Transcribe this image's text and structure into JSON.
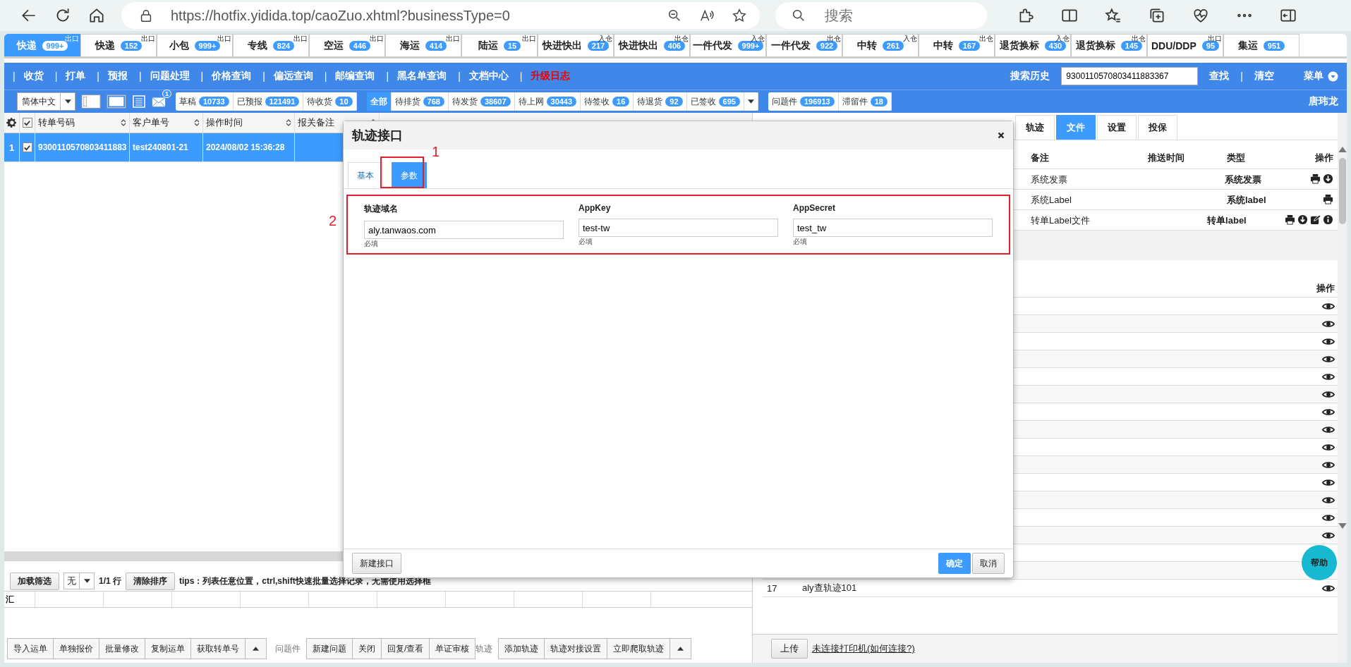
{
  "browser": {
    "url": "https://hotfix.yidida.top/caoZuo.xhtml?businessType=0",
    "search_placeholder": "搜索"
  },
  "type_tabs": [
    {
      "label": "快递",
      "count": "999+",
      "tag": "出口",
      "selected": true
    },
    {
      "label": "快递",
      "count": "152",
      "tag": "出口",
      "selected": false
    },
    {
      "label": "小包",
      "count": "999+",
      "tag": "出口",
      "selected": false
    },
    {
      "label": "专线",
      "count": "824",
      "tag": "出口",
      "selected": false
    },
    {
      "label": "空运",
      "count": "446",
      "tag": "出口",
      "selected": false
    },
    {
      "label": "海运",
      "count": "414",
      "tag": "出口",
      "selected": false
    },
    {
      "label": "陆运",
      "count": "15",
      "tag": "出口",
      "selected": false
    },
    {
      "label": "快进快出",
      "count": "217",
      "tag": "入仓",
      "selected": false
    },
    {
      "label": "快进快出",
      "count": "406",
      "tag": "出仓",
      "selected": false
    },
    {
      "label": "一件代发",
      "count": "999+",
      "tag": "入仓",
      "selected": false
    },
    {
      "label": "一件代发",
      "count": "922",
      "tag": "出仓",
      "selected": false
    },
    {
      "label": "中转",
      "count": "261",
      "tag": "入仓",
      "selected": false
    },
    {
      "label": "中转",
      "count": "167",
      "tag": "出仓",
      "selected": false
    },
    {
      "label": "退货换标",
      "count": "430",
      "tag": "入仓",
      "selected": false
    },
    {
      "label": "退货换标",
      "count": "145",
      "tag": "出仓",
      "selected": false
    },
    {
      "label": "DDU/DDP",
      "count": "95",
      "tag": "出口",
      "selected": false
    },
    {
      "label": "集运",
      "count": "951",
      "selected": false
    }
  ],
  "menu": {
    "items": [
      {
        "sep": "|",
        "label": "收货",
        "kind": "normal"
      },
      {
        "sep": "|",
        "label": "打单",
        "kind": "normal"
      },
      {
        "sep": "|",
        "label": "预报",
        "kind": "normal"
      },
      {
        "sep": "|",
        "label": "问题处理",
        "kind": "normal"
      },
      {
        "sep": "|",
        "label": "价格查询",
        "kind": "normal"
      },
      {
        "sep": "|",
        "label": "偏远查询",
        "kind": "normal"
      },
      {
        "sep": "|",
        "label": "邮编查询",
        "kind": "normal"
      },
      {
        "sep": "|",
        "label": "黑名单查询",
        "kind": "normal"
      },
      {
        "sep": "|",
        "label": "文档中心",
        "kind": "normal"
      },
      {
        "sep": "|",
        "label": "升级日志",
        "kind": "highlight"
      }
    ],
    "find_separator": "|",
    "history_label": "搜索历史",
    "history_value": "9300110570803411883367",
    "find": "查找",
    "clear": "清空",
    "menu_label": "菜单"
  },
  "toolbar": {
    "language": "简体中文",
    "mail_badge": "1",
    "draft_group": [
      {
        "label": "草稿",
        "count": "10733"
      },
      {
        "label": "已预报",
        "count": "121491"
      },
      {
        "label": "待收货",
        "count": "10"
      }
    ],
    "status_group": [
      {
        "label": "全部",
        "selected": true
      },
      {
        "label": "待排货",
        "count": "768",
        "selected": false
      },
      {
        "label": "待发货",
        "count": "38607",
        "selected": false
      },
      {
        "label": "待上网",
        "count": "30443",
        "selected": false
      },
      {
        "label": "待签收",
        "count": "16",
        "selected": false
      },
      {
        "label": "待退货",
        "count": "92",
        "selected": false
      },
      {
        "label": "已签收",
        "count": "695",
        "selected": false
      }
    ],
    "problem_group": [
      {
        "label": "问题件",
        "count": "196913"
      },
      {
        "label": "滞留件",
        "count": "18"
      }
    ],
    "user": "唐玮龙"
  },
  "grid": {
    "header_checked": true,
    "columns": [
      "转单号码",
      "客户单号",
      "操作时间",
      "报关备注"
    ],
    "rows": [
      {
        "index": "1",
        "checked": true,
        "selected": true,
        "cells": [
          "9300110570803411883",
          "test240801-21",
          "2024/08/02 15:36:28",
          ""
        ]
      }
    ]
  },
  "filter_bar": {
    "load": "加载筛选",
    "select_value": "无",
    "count": "1/1 行",
    "clear": "清除排序",
    "tips": "tips：列表任意位置，ctrl,shift快速批量选择记录，无需使用选择框"
  },
  "summary": {
    "label": "汇"
  },
  "actions": [
    {
      "kind": "button",
      "label": "导入运单"
    },
    {
      "kind": "button",
      "label": "单独报价"
    },
    {
      "kind": "button",
      "label": "批量修改"
    },
    {
      "kind": "button",
      "label": "复制运单"
    },
    {
      "kind": "button",
      "label": "获取转单号"
    },
    {
      "kind": "more"
    },
    {
      "kind": "label",
      "label": "问题件"
    },
    {
      "kind": "button",
      "label": "新建问题"
    },
    {
      "kind": "button",
      "label": "关闭"
    },
    {
      "kind": "button",
      "label": "回复/查看"
    },
    {
      "kind": "button",
      "label": "单证审核"
    },
    {
      "kind": "label",
      "label": "轨迹"
    },
    {
      "kind": "button",
      "label": "添加轨迹"
    },
    {
      "kind": "button",
      "label": "轨迹对接设置"
    },
    {
      "kind": "button",
      "label": "立即爬取轨迹"
    },
    {
      "kind": "more"
    }
  ],
  "detail_tabs": [
    {
      "label": "轨迹",
      "selected": false
    },
    {
      "label": "文件",
      "selected": true
    },
    {
      "label": "设置",
      "selected": false
    },
    {
      "label": "投保",
      "selected": false
    }
  ],
  "files": {
    "columns": [
      "备注",
      "推送时间",
      "类型",
      "操作"
    ],
    "rows": [
      {
        "note": "系统发票",
        "type": "系统发票",
        "actions": [
          {
            "kind": "print"
          },
          {
            "kind": "download"
          }
        ]
      },
      {
        "note": "系统Label",
        "type": "系统label",
        "actions": [
          {
            "kind": "print"
          }
        ]
      },
      {
        "note": "转单Label文件",
        "type": "转单label",
        "actions": [
          {
            "kind": "print"
          },
          {
            "kind": "download"
          },
          {
            "kind": "edit"
          },
          {
            "kind": "info"
          }
        ]
      }
    ]
  },
  "tracks": {
    "action_column": "操作",
    "rows": [
      {
        "view": true
      },
      {
        "view": true
      },
      {
        "view": true
      },
      {
        "view": true
      },
      {
        "view": true
      },
      {
        "view": true
      },
      {
        "view": true
      },
      {
        "view": true
      },
      {
        "view": true
      },
      {
        "view": true
      },
      {
        "view": true
      },
      {
        "view": true
      },
      {
        "view": true
      },
      {
        "view": true
      },
      {
        "view": false
      },
      {
        "view": false
      },
      {
        "index": "17",
        "text": "aly查轨迹101",
        "view": true
      }
    ]
  },
  "footer": {
    "upload": "上传",
    "printer_link": "未连接打印机(如何连接?)"
  },
  "help": "帮助",
  "dialog": {
    "title": "轨迹接口",
    "tabs": [
      {
        "label": "基本",
        "selected": false
      },
      {
        "label": "参数",
        "selected": true
      }
    ],
    "fields": [
      {
        "label": "轨迹域名",
        "value": "aly.tanwaos.com",
        "hint": "必填"
      },
      {
        "label": "AppKey",
        "value": "test-tw",
        "hint": "必填"
      },
      {
        "label": "AppSecret",
        "value": "test_tw",
        "hint": "必填"
      }
    ],
    "tab_marker": "1",
    "fields_marker": "2",
    "new_button": "新建接口",
    "ok": "确定",
    "cancel": "取消"
  }
}
